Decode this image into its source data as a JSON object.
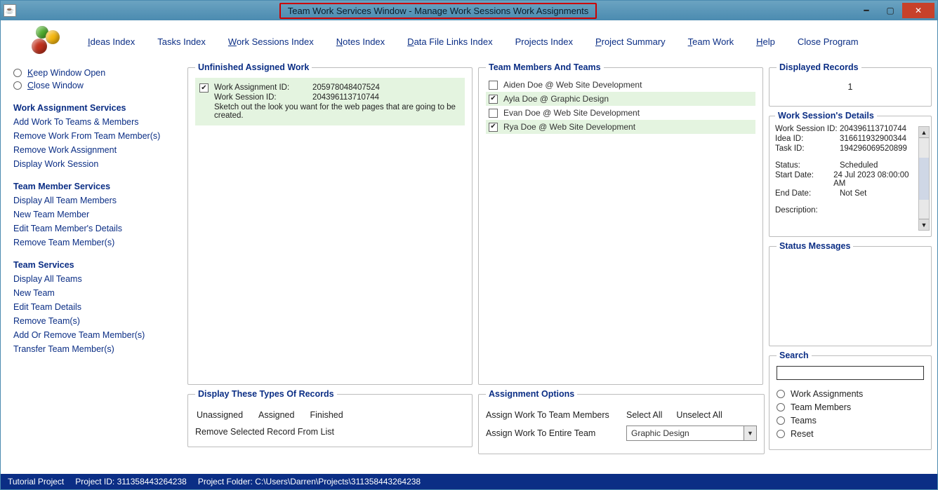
{
  "window": {
    "title": "Team Work Services Window - Manage Work Sessions Work Assignments"
  },
  "menu": {
    "ideas": "Ideas Index",
    "tasks": "Tasks Index",
    "work_sessions": "Work Sessions Index",
    "notes": "Notes Index",
    "data_files": "Data File Links Index",
    "projects": "Projects Index",
    "summary": "Project Summary",
    "team_work": "Team Work",
    "help": "Help",
    "close": "Close Program"
  },
  "sidebar": {
    "keep_open": "Keep Window Open",
    "close_window": "Close Window",
    "groups": {
      "wa": {
        "title": "Work Assignment Services",
        "links": [
          "Add Work To Teams & Members",
          "Remove Work From Team Member(s)",
          "Remove Work Assignment",
          "Display Work Session"
        ]
      },
      "tm": {
        "title": "Team Member Services",
        "links": [
          "Display All Team Members",
          "New Team Member",
          "Edit Team Member's Details",
          "Remove Team Member(s)"
        ]
      },
      "ts": {
        "title": "Team Services",
        "links": [
          "Display All Teams",
          "New Team",
          "Edit Team Details",
          "Remove Team(s)",
          "Add Or Remove Team Member(s)",
          "Transfer Team Member(s)"
        ]
      }
    }
  },
  "unfinished": {
    "legend": "Unfinished Assigned Work",
    "item": {
      "wa_id_label": "Work Assignment ID:",
      "wa_id": "205978048407524",
      "ws_id_label": "Work Session ID:",
      "ws_id": "204396113710744",
      "desc": "Sketch out the look you want for the web pages that are going to be created."
    }
  },
  "members": {
    "legend": "Team Members And Teams",
    "rows": [
      {
        "checked": false,
        "label": "Aiden Doe @ Web Site Development"
      },
      {
        "checked": true,
        "label": "Ayla Doe @ Graphic Design"
      },
      {
        "checked": false,
        "label": "Evan Doe @ Web Site Development"
      },
      {
        "checked": true,
        "label": "Rya Doe @ Web Site Development"
      }
    ]
  },
  "displayed": {
    "legend": "Displayed Records",
    "value": "1"
  },
  "details": {
    "legend": "Work Session's Details",
    "ws_id_l": "Work Session ID:",
    "ws_id": "204396113710744",
    "idea_l": "Idea ID:",
    "idea": "316611932900344",
    "task_l": "Task ID:",
    "task": "194296069520899",
    "status_l": "Status:",
    "status": "Scheduled",
    "start_l": "Start Date:",
    "start": "24 Jul 2023  08:00:00 AM",
    "end_l": "End Date:",
    "end": "Not Set",
    "desc_l": "Description:"
  },
  "status_msgs": {
    "legend": "Status Messages"
  },
  "search": {
    "legend": "Search",
    "options": [
      "Work Assignments",
      "Team Members",
      "Teams",
      "Reset"
    ]
  },
  "display_types": {
    "legend": "Display These Types Of Records",
    "row1": [
      "Unassigned",
      "Assigned",
      "Finished"
    ],
    "remove": "Remove Selected Record From List"
  },
  "assign_opts": {
    "legend": "Assignment Options",
    "assign_members": "Assign Work To Team Members",
    "select_all": "Select All",
    "unselect_all": "Unselect All",
    "assign_team": "Assign Work To Entire Team",
    "team_selected": "Graphic Design"
  },
  "statusbar": {
    "proj": "Tutorial Project",
    "proj_id": "Project ID: 311358443264238",
    "folder": "Project Folder: C:\\Users\\Darren\\Projects\\311358443264238"
  }
}
